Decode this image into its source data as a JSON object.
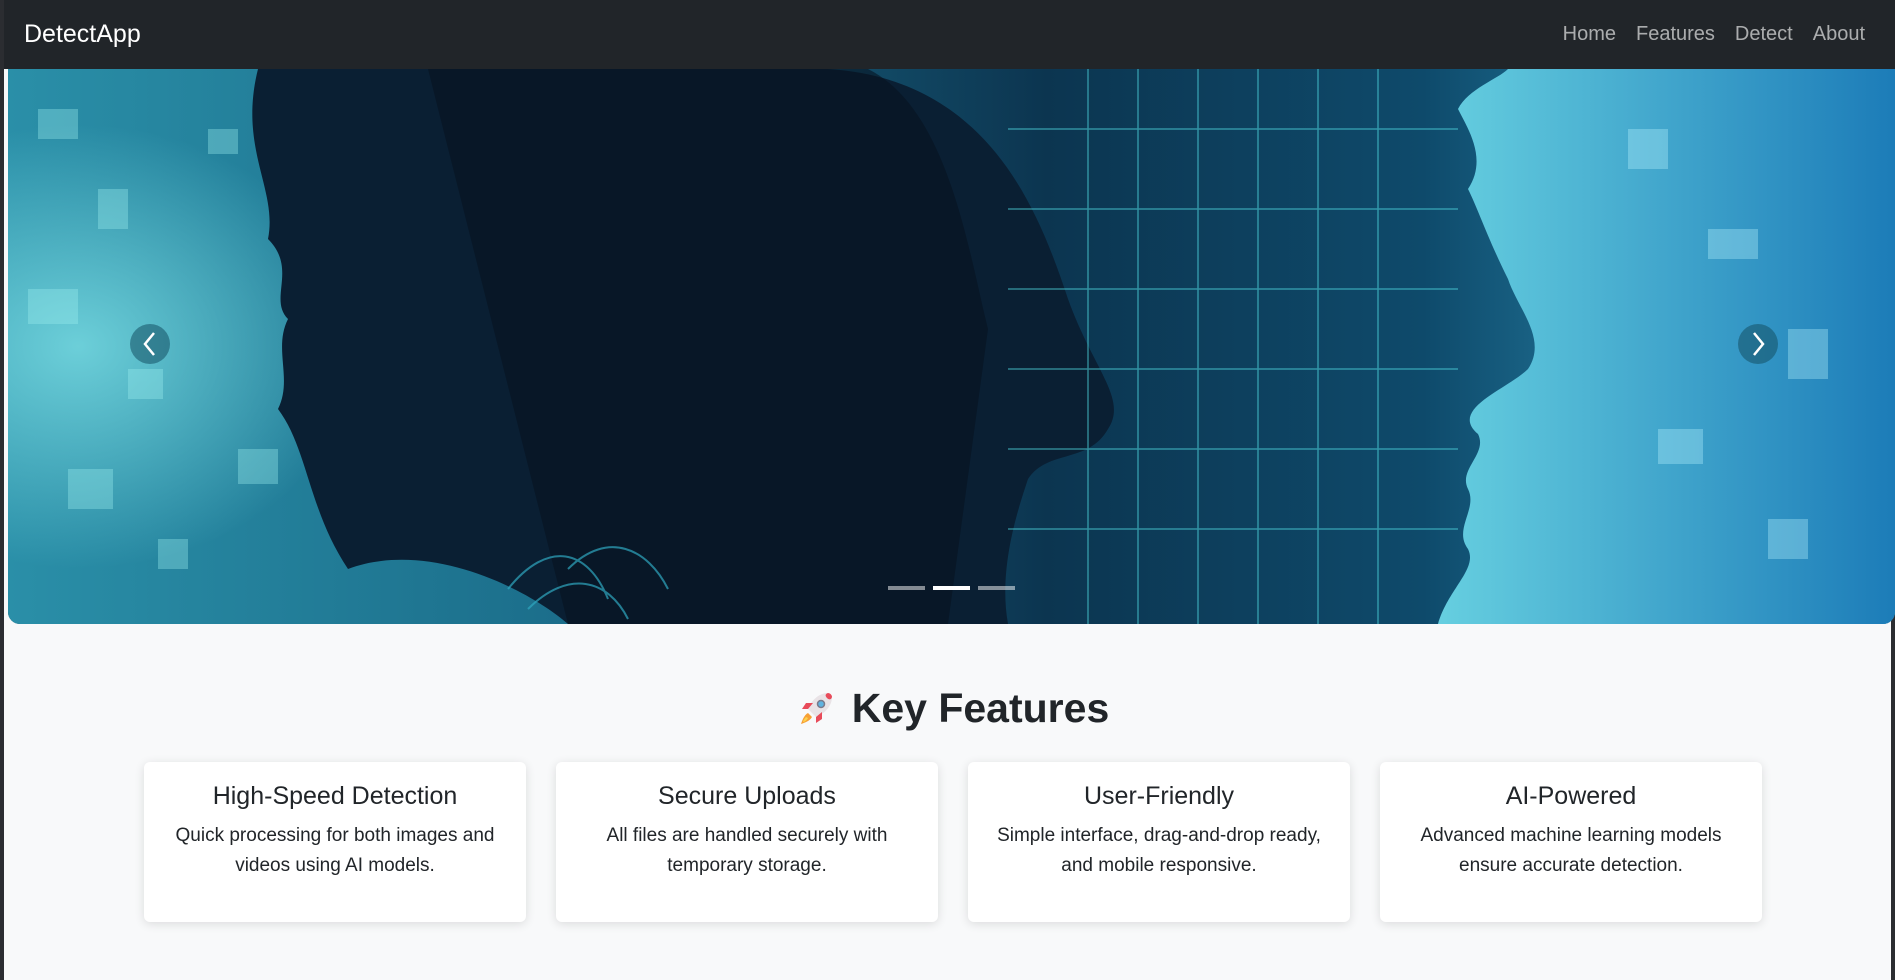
{
  "navbar": {
    "brand": "DetectApp",
    "links": [
      "Home",
      "Features",
      "Detect",
      "About"
    ]
  },
  "carousel": {
    "slide_count": 3,
    "active_index": 1,
    "prev_icon": "chevron-left-icon",
    "next_icon": "chevron-right-icon"
  },
  "features": {
    "emoji": "rocket-icon",
    "title": "Key Features",
    "cards": [
      {
        "title": "High-Speed Detection",
        "text": "Quick processing for both images and videos using AI models."
      },
      {
        "title": "Secure Uploads",
        "text": "All files are handled securely with temporary storage."
      },
      {
        "title": "User-Friendly",
        "text": "Simple interface, drag-and-drop ready, and mobile responsive."
      },
      {
        "title": "AI-Powered",
        "text": "Advanced machine learning models ensure accurate detection."
      }
    ]
  },
  "colors": {
    "navbar_bg": "#212529",
    "page_bg": "#f8f9fa",
    "card_bg": "#ffffff",
    "hero_teal": "#1fa3b8"
  }
}
